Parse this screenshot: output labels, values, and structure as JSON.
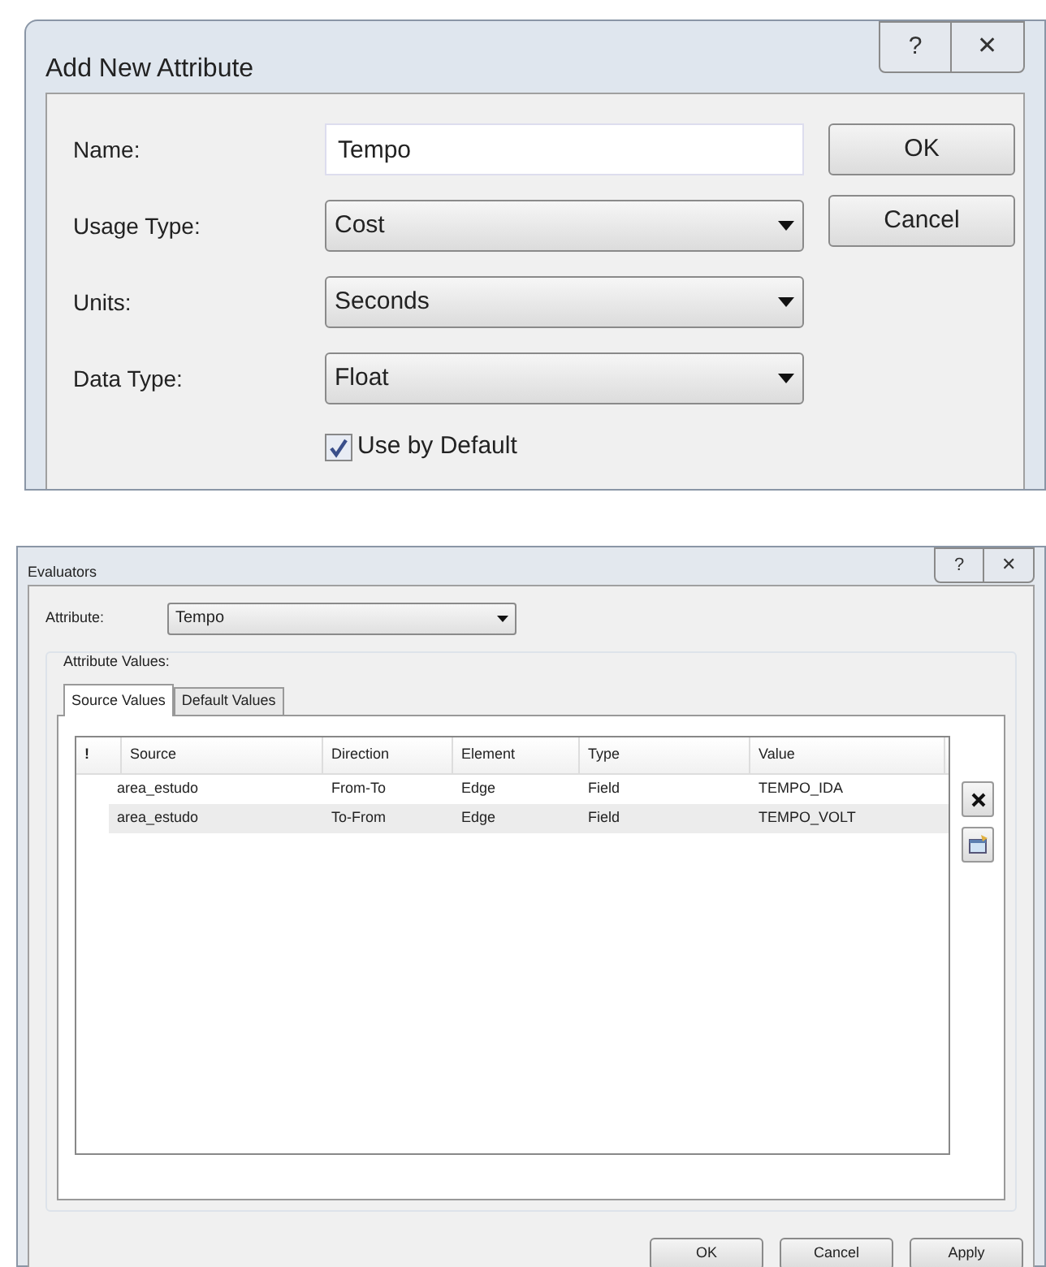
{
  "add_attribute_dialog": {
    "title": "Add New Attribute",
    "title_buttons": [
      "?",
      "✕"
    ],
    "fields": [
      {
        "kind": "text",
        "label": "Name:",
        "value": "Tempo"
      },
      {
        "kind": "dropdown",
        "label": "Usage Type:",
        "value": "Cost"
      },
      {
        "kind": "dropdown",
        "label": "Units:",
        "value": "Seconds"
      },
      {
        "kind": "dropdown",
        "label": "Data Type:",
        "value": "Float"
      }
    ],
    "use_by_default": {
      "label": "Use by Default",
      "checked": true
    },
    "buttons": [
      "OK",
      "Cancel"
    ]
  },
  "evaluators_dialog": {
    "title": "Evaluators",
    "title_buttons": [
      "?",
      "✕"
    ],
    "attribute": {
      "label": "Attribute:",
      "value": "Tempo"
    },
    "group_label": "Attribute Values:",
    "tabs": [
      {
        "label": "Source Values",
        "selected": true
      },
      {
        "label": "Default Values",
        "selected": false
      }
    ],
    "table": {
      "columns": [
        "!",
        "Source",
        "Direction",
        "Element",
        "Type",
        "Value"
      ],
      "rows": [
        {
          "cells": [
            "",
            "area_estudo",
            "From-To",
            "Edge",
            "Field",
            "TEMPO_IDA"
          ],
          "selected": false
        },
        {
          "cells": [
            "",
            "area_estudo",
            "To-From",
            "Edge",
            "Field",
            "TEMPO_VOLT"
          ],
          "selected": true
        }
      ]
    },
    "buttons": [
      "OK",
      "Cancel",
      "Apply"
    ]
  }
}
